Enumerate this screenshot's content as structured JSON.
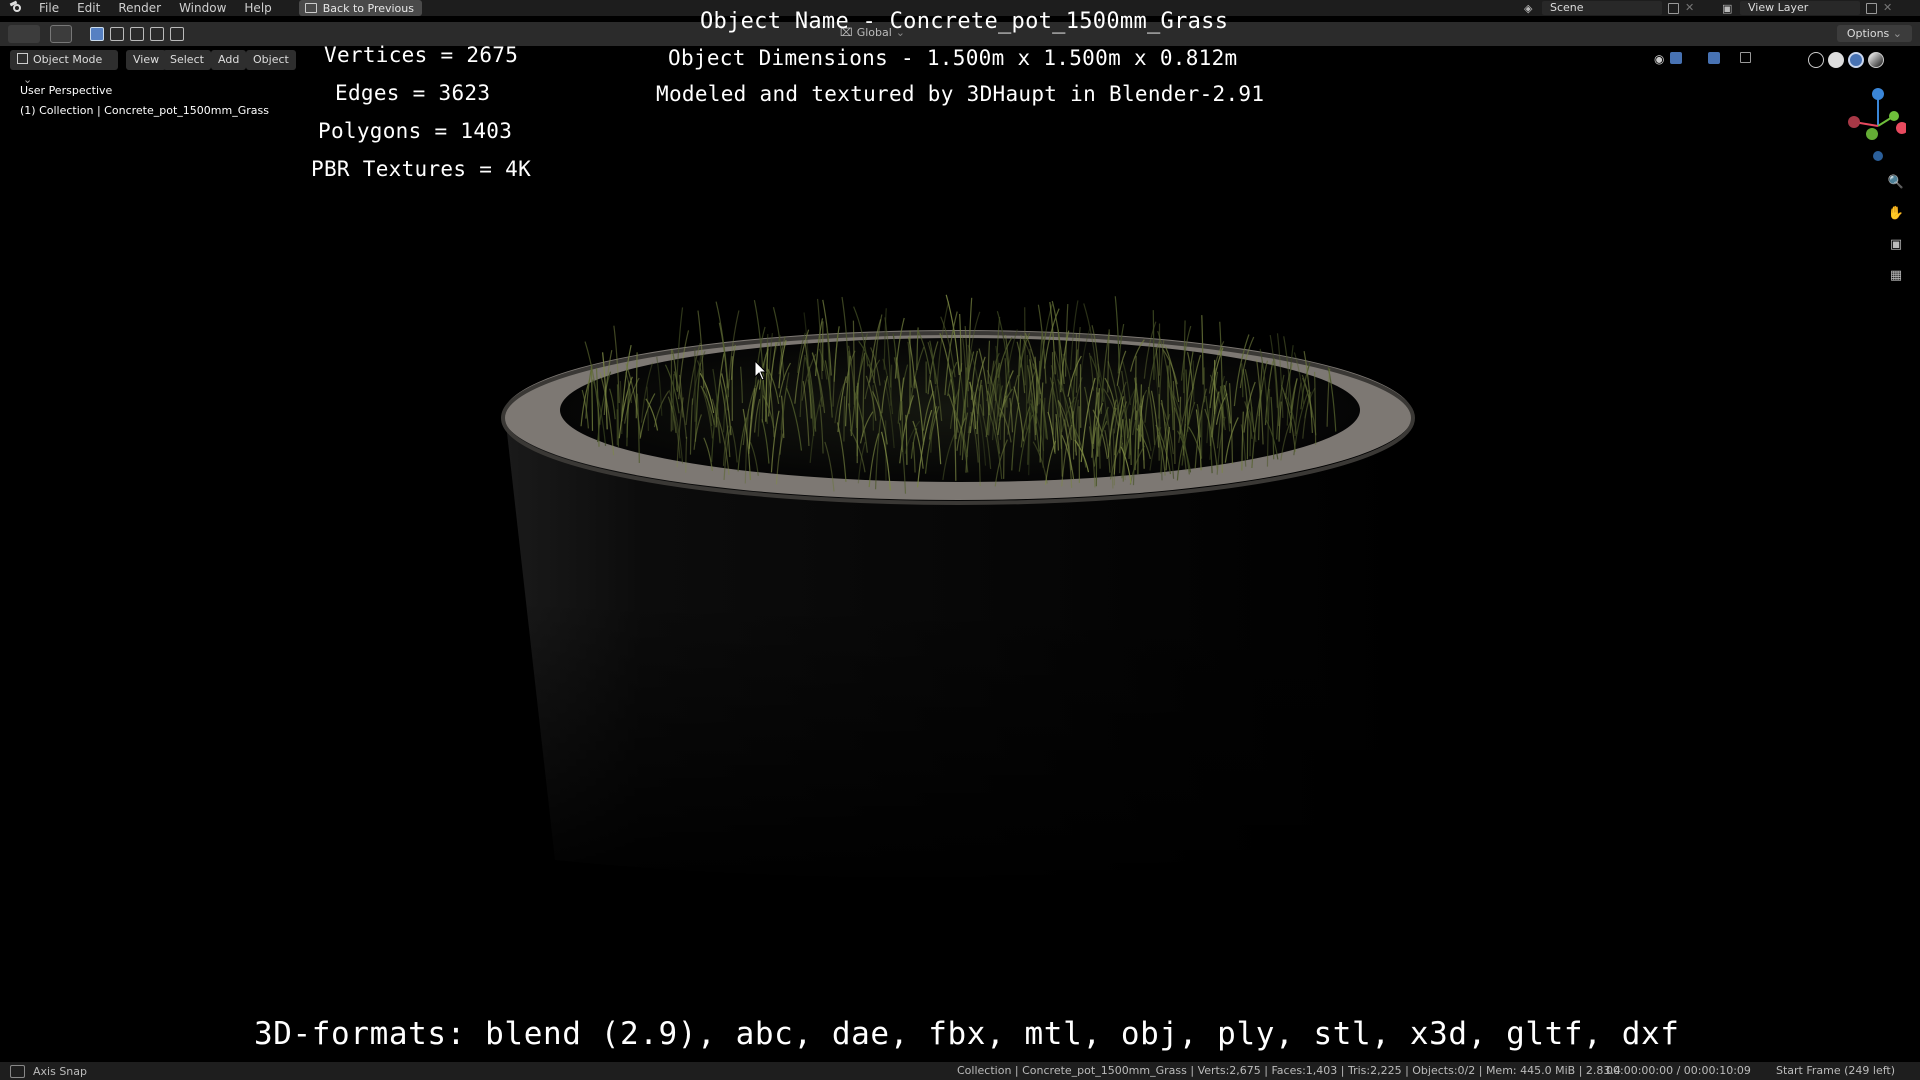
{
  "menu": {
    "items": [
      "File",
      "Edit",
      "Render",
      "Window",
      "Help"
    ],
    "back_button": "Back to Previous"
  },
  "top_right": {
    "scene_label": "Scene",
    "view_layer_label": "View Layer"
  },
  "header": {
    "transform_orientation": "Global",
    "options_label": "Options"
  },
  "viewport_header": {
    "mode_label": "Object Mode",
    "view_label": "View",
    "select_label": "Select",
    "add_label": "Add",
    "object_label": "Object"
  },
  "viewport": {
    "perspective_label": "User Perspective",
    "collection_path": "(1) Collection | Concrete_pot_1500mm_Grass"
  },
  "overlay": {
    "vertices": "Vertices = 2675",
    "edges": "Edges = 3623",
    "polygons": "Polygons = 1403",
    "textures": "PBR Textures = 4K",
    "object_name": "Object Name - Concrete_pot_1500mm_Grass",
    "object_dimensions": "Object Dimensions -  1.500m x 1.500m x 0.812m",
    "modeled_by": "Modeled and textured by 3DHaupt in Blender-2.91",
    "formats": "3D-formats: blend (2.9), abc, dae, fbx, mtl, obj, ply, stl, x3d, gltf, dxf"
  },
  "status": {
    "axis_snap": "Axis Snap",
    "info": "Collection | Concrete_pot_1500mm_Grass | Verts:2,675 | Faces:1,403 | Tris:2,225 | Objects:0/2 | Mem: 445.0 MiB | 2.83.4",
    "time": "00:00:00:00 / 00:00:10:09",
    "frame": "Start Frame (249 left)"
  },
  "colors": {
    "accent": "#4772b3",
    "axis_x": "#e84a5f",
    "axis_y": "#6fbf3b",
    "axis_z": "#3a86d8",
    "pot_rim": "#8a8580",
    "grass": "#6c7a3a"
  },
  "icons": [
    "blender-logo",
    "back-icon",
    "select-box-icon",
    "transform-icon",
    "zoom-icon",
    "hand-icon",
    "camera-icon",
    "grid-icon",
    "cursor-pointer-icon"
  ]
}
